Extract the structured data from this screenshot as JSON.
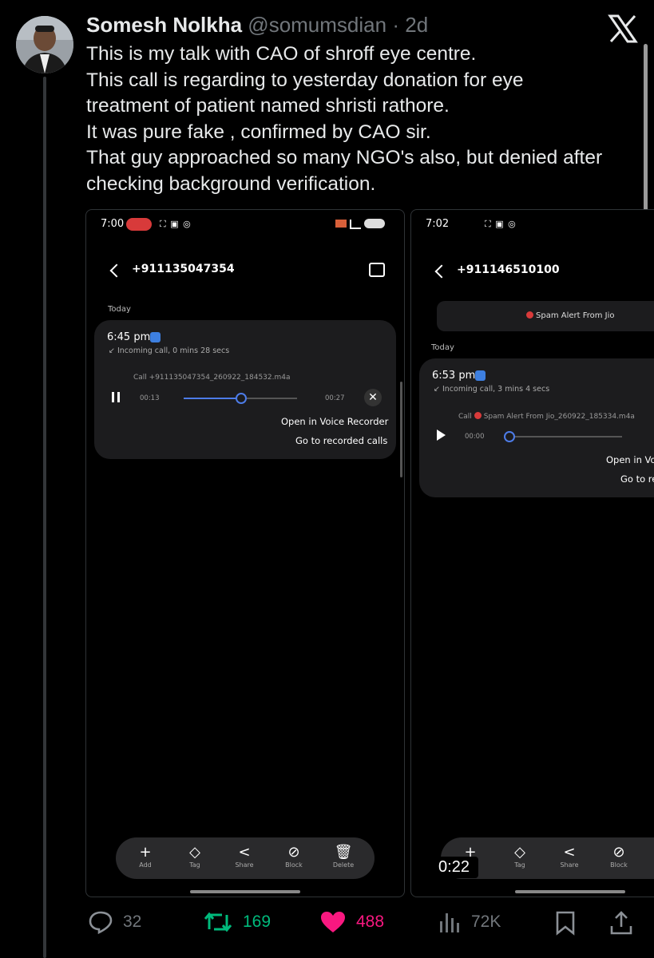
{
  "tweet": {
    "author_name": "Somesh Nolkha",
    "handle": "@somumsdian",
    "separator": "·",
    "time": "2d",
    "lines": [
      "This is my talk with  CAO of shroff eye centre.",
      "This call is regarding to yesterday donation for eye",
      "treatment of patient named shristi rathore.",
      "It was pure fake , confirmed by CAO sir.",
      "That guy approached so many NGO's also, but denied after",
      "checking background verification."
    ]
  },
  "phone1": {
    "status_time": "7:00",
    "status_icons": "⛶ ▣ ◎",
    "number": "+911135047354",
    "day_label": "Today",
    "call_time": "6:45 pm",
    "call_info": "Incoming call, 0 mins 28 secs",
    "file_name": "Call +911135047354_260922_184532.m4a",
    "elapsed": "00:13",
    "duration": "00:27",
    "progress": 0.5,
    "open_link": "Open in Voice Recorder",
    "recorded_link": "Go to recorded calls",
    "actions": [
      {
        "icon": "+",
        "label": "Add"
      },
      {
        "icon": "◇",
        "label": "Tag"
      },
      {
        "icon": "<",
        "label": "Share"
      },
      {
        "icon": "⊘",
        "label": "Block"
      },
      {
        "icon": "🗑",
        "label": "Delete"
      }
    ]
  },
  "phone2": {
    "status_time": "7:02",
    "status_icons": "⛶ ▣ ◎",
    "number": "+911146510100",
    "spam_alert": "Spam Alert From Jio",
    "day_label": "Today",
    "call_time": "6:53 pm",
    "call_info": "Incoming call, 3 mins 4 secs",
    "file_prefix": "Call",
    "file_name": "Spam Alert From Jio_260922_185334.m4a",
    "elapsed": "00:00",
    "progress": 0,
    "open_link": "Open in Vo",
    "recorded_link": "Go to re",
    "actions": [
      {
        "icon": "+",
        "label": "Add"
      },
      {
        "icon": "◇",
        "label": "Tag"
      },
      {
        "icon": "<",
        "label": "Share"
      },
      {
        "icon": "⊘",
        "label": "Block"
      }
    ]
  },
  "video_timestamp": "0:22",
  "engagement": {
    "replies": "32",
    "retweets": "169",
    "likes": "488",
    "views": "72K"
  },
  "colors": {
    "retweet": "#00ba7c",
    "like": "#f91880",
    "muted": "#71767b"
  }
}
